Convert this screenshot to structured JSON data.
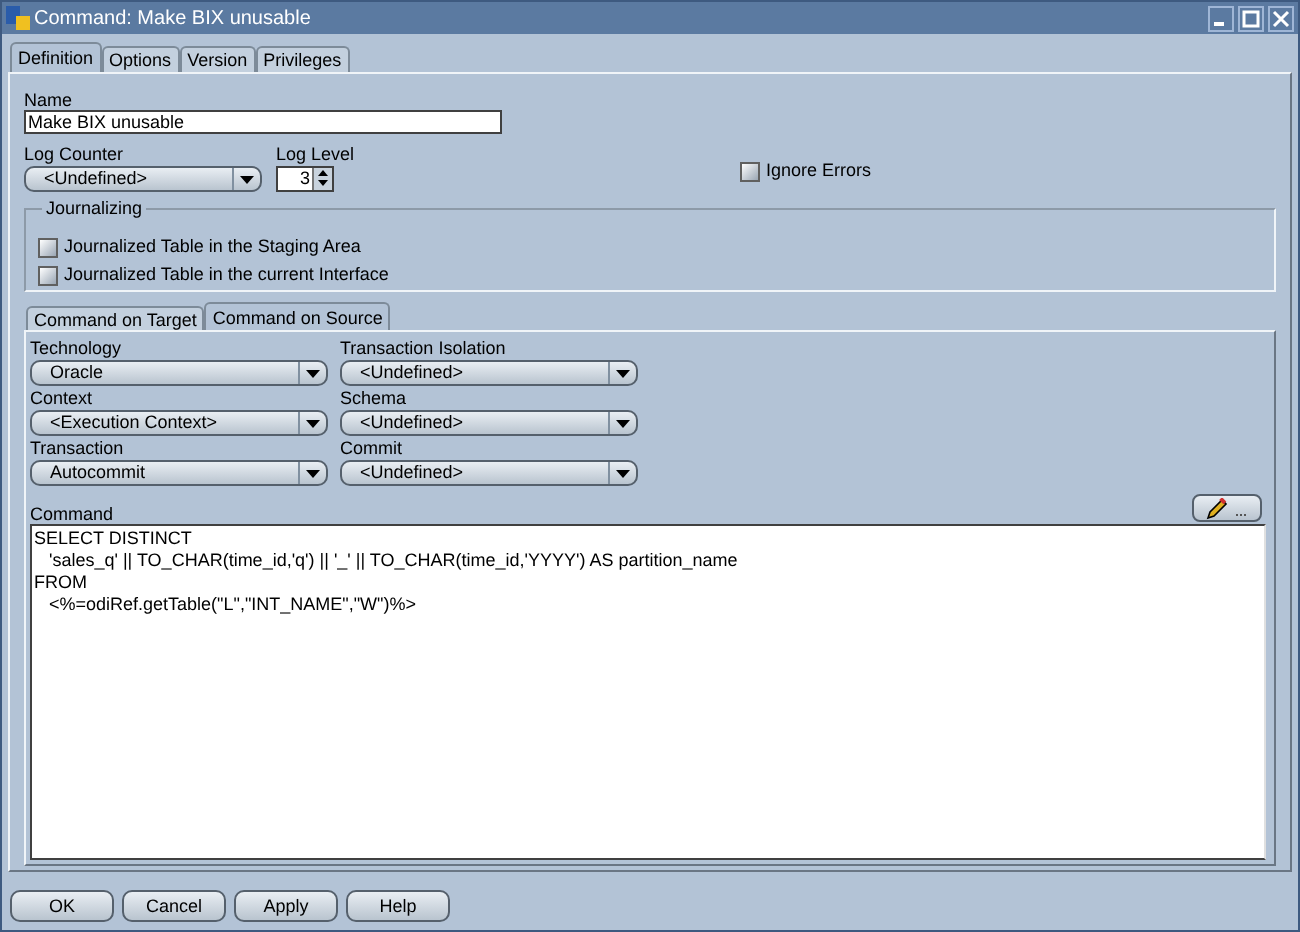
{
  "window": {
    "title": "Command: Make BIX unusable"
  },
  "tabs": [
    {
      "label": "Definition",
      "selected": true
    },
    {
      "label": "Options",
      "selected": false
    },
    {
      "label": "Version",
      "selected": false
    },
    {
      "label": "Privileges",
      "selected": false
    }
  ],
  "name": {
    "label": "Name",
    "value": "Make BIX unusable"
  },
  "log_counter": {
    "label": "Log Counter",
    "value": "<Undefined>"
  },
  "log_level": {
    "label": "Log Level",
    "value": "3"
  },
  "ignore_errors": {
    "label": "Ignore Errors",
    "checked": false
  },
  "journalizing": {
    "title": "Journalizing",
    "options": [
      {
        "label": "Journalized Table in the Staging Area",
        "checked": false
      },
      {
        "label": "Journalized Table in the current Interface",
        "checked": false
      }
    ]
  },
  "sub_tabs": [
    {
      "label": "Command on Target",
      "selected": false
    },
    {
      "label": "Command on Source",
      "selected": true
    }
  ],
  "fields": [
    {
      "label": "Technology",
      "value": "Oracle"
    },
    {
      "label": "Transaction Isolation",
      "value": "<Undefined>"
    },
    {
      "label": "Context",
      "value": "<Execution Context>"
    },
    {
      "label": "Schema",
      "value": "<Undefined>"
    },
    {
      "label": "Transaction",
      "value": "Autocommit"
    },
    {
      "label": "Commit",
      "value": "<Undefined>"
    }
  ],
  "command": {
    "label": "Command",
    "lines": [
      "SELECT DISTINCT",
      "   'sales_q' || TO_CHAR(time_id,'q') || '_' || TO_CHAR(time_id,'YYYY') AS partition_name",
      "FROM",
      "   <%=odiRef.getTable(\"L\",\"INT_NAME\",\"W\")%>"
    ]
  },
  "buttons": [
    "OK",
    "Cancel",
    "Apply",
    "Help"
  ]
}
